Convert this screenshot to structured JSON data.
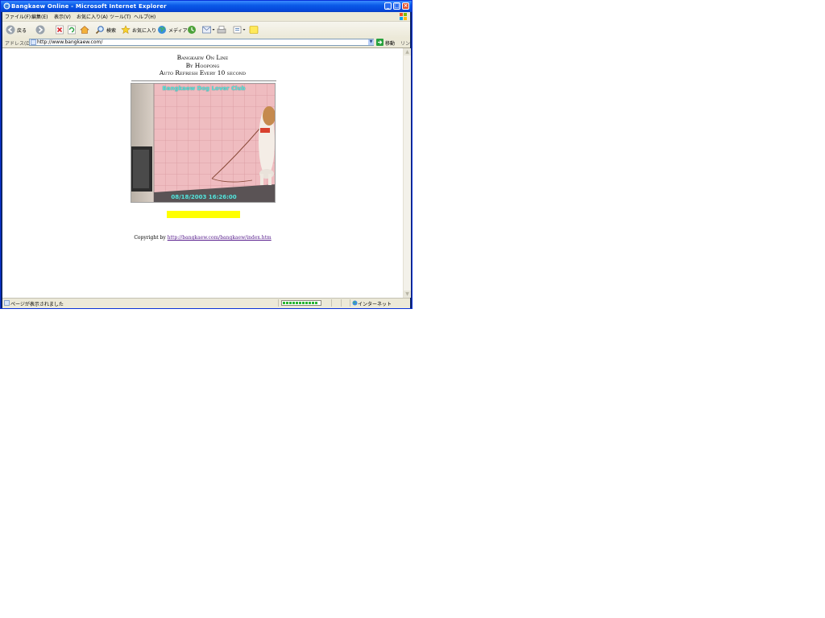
{
  "window": {
    "title": "Bangkaew Online - Microsoft Internet Explorer"
  },
  "menubar": {
    "items": [
      "ファイル(F)",
      "編集(E)",
      "表示(V)",
      "お気に入り(A)",
      "ツール(T)",
      "ヘルプ(H)"
    ]
  },
  "toolbar": {
    "back_label": "戻る",
    "search_label": "検索",
    "favorites_label": "お気に入り",
    "media_label": "メディア"
  },
  "addressbar": {
    "label": "アドレス(D)",
    "url": "http://www.bangkaew.com/",
    "go_label": "移動",
    "links_label": "リンク"
  },
  "page": {
    "title_line1": "Bangkaew On Line",
    "title_line2": "By Hoopong",
    "title_line3": "Auto Refresh Every 10 second",
    "camera_caption_top": "Bangkaew Dog Lover Club",
    "camera_caption_bottom": "08/18/2003 16:26:00",
    "copyright_text": "Copyright by",
    "copyright_link": "http://bangkaew.com/bangkaew/index.htm"
  },
  "statusbar": {
    "text": "ページが表示されました",
    "zone": "インターネット",
    "progress": 0.95
  },
  "colors": {
    "titlebar": "#0a5ae8",
    "highlight_bar": "#ffff00",
    "camera_caption": "#5ce0d8"
  }
}
